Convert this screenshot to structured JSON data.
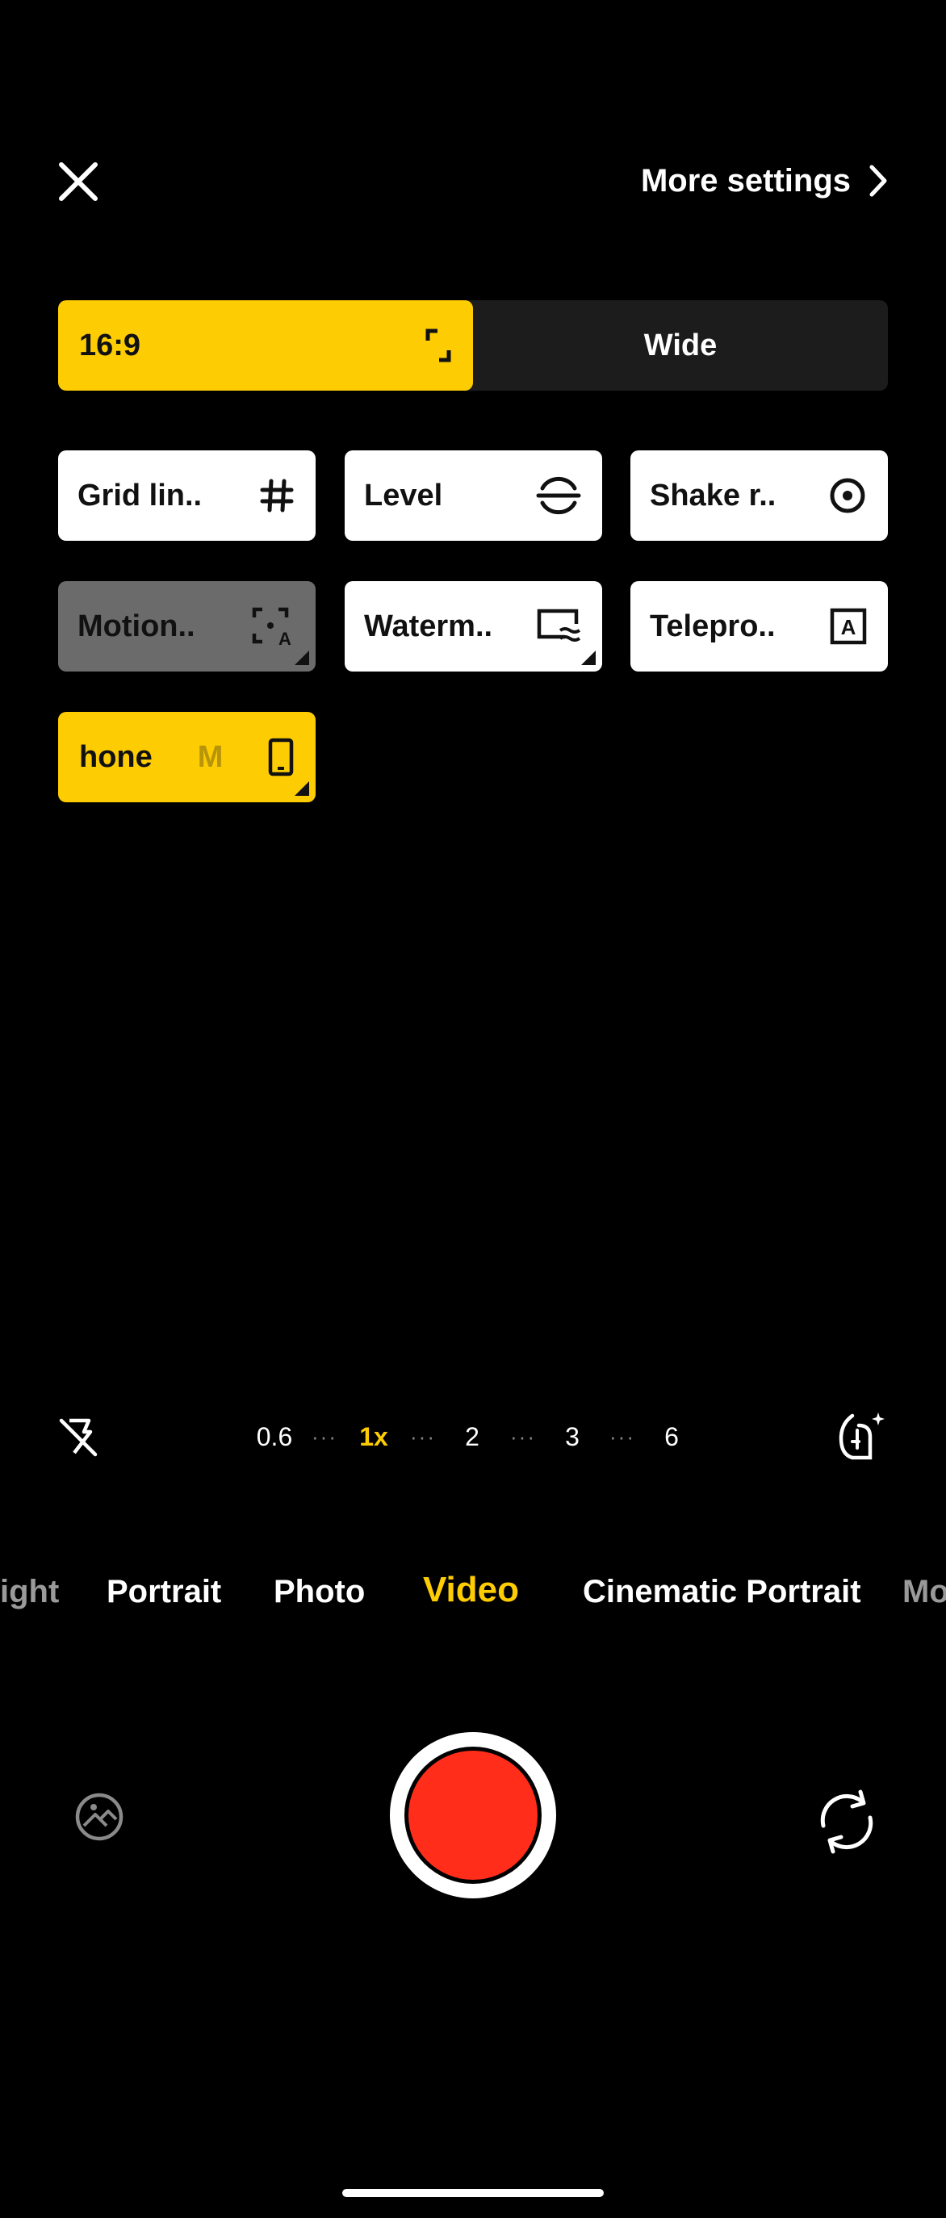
{
  "header": {
    "more_settings": "More settings"
  },
  "aspect": {
    "selected": "16:9",
    "other": "Wide"
  },
  "tiles": {
    "grid": "Grid lin..",
    "level": "Level",
    "shake": "Shake r..",
    "motion": "Motion..",
    "watermark": "Waterm..",
    "teleprompter": "Telepro..",
    "phone_a": "hone",
    "phone_b": "M"
  },
  "zoom": {
    "z06": "0.6",
    "z1": "1x",
    "z2": "2",
    "z3": "3",
    "z6": "6",
    "dots": "···"
  },
  "modes": {
    "night": "ight",
    "portrait": "Portrait",
    "photo": "Photo",
    "video": "Video",
    "cinematic": "Cinematic Portrait",
    "more": "Mo"
  },
  "colors": {
    "accent": "#fdcc02",
    "record": "#ff2d1a"
  }
}
